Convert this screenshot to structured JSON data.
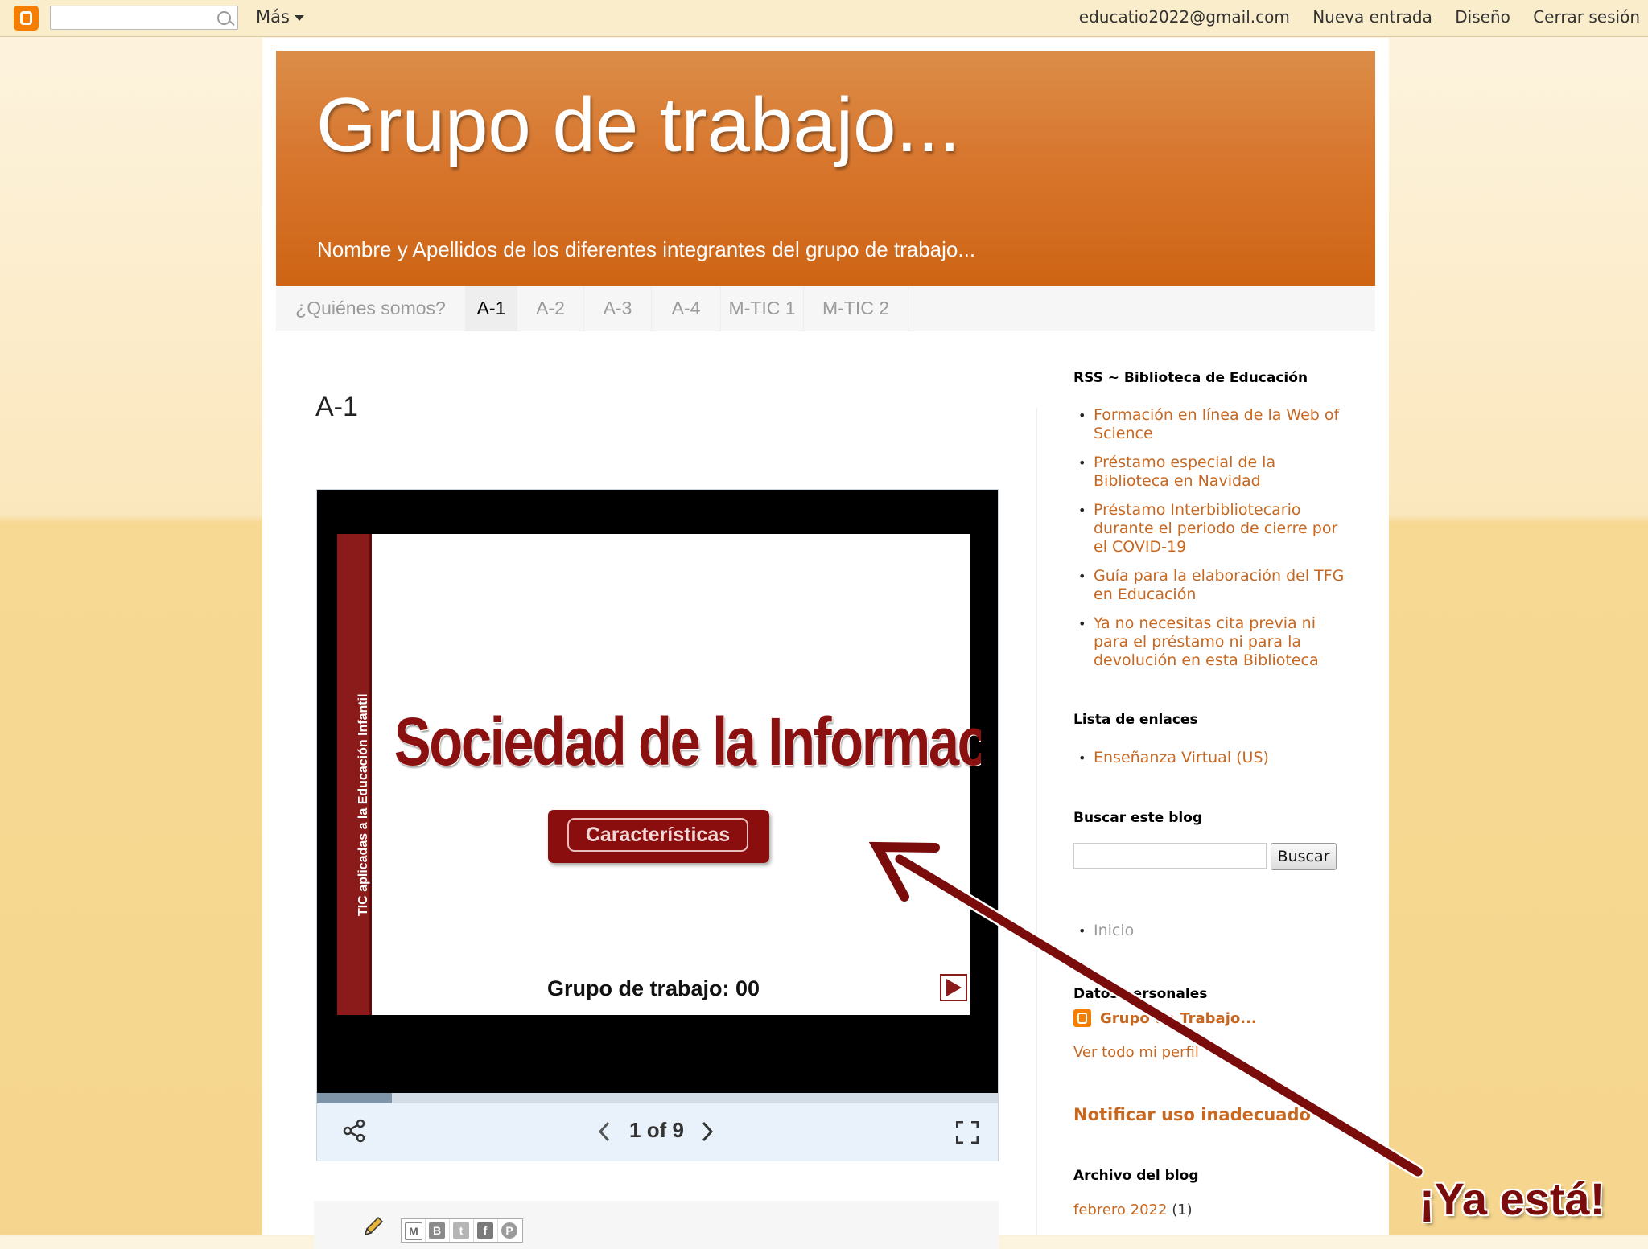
{
  "navbar": {
    "search_placeholder": "",
    "more_label": "Más",
    "email": "educatio2022@gmail.com",
    "new_post": "Nueva entrada",
    "design": "Diseño",
    "sign_out": "Cerrar sesión"
  },
  "header": {
    "title": "Grupo de trabajo...",
    "description": "Nombre y Apellidos de los diferentes integrantes del grupo de trabajo..."
  },
  "tabs": [
    {
      "label": "¿Quiénes somos?",
      "active": false
    },
    {
      "label": "A-1",
      "active": true
    },
    {
      "label": "A-2",
      "active": false
    },
    {
      "label": "A-3",
      "active": false
    },
    {
      "label": "A-4",
      "active": false
    },
    {
      "label": "M-TIC 1",
      "active": false
    },
    {
      "label": "M-TIC 2",
      "active": false
    }
  ],
  "post": {
    "title": "A-1"
  },
  "slideshow": {
    "vertical_text": "TIC aplicadas a la Educación Infantil",
    "slide_title": "Sociedad de la Información",
    "button_label": "Características",
    "footer": "Grupo de trabajo: 00",
    "page_indicator": "1 of 9",
    "progress": 0.11
  },
  "sidebar": {
    "rss_title": "RSS ~ Biblioteca de Educación",
    "rss_items": [
      "Formación en línea de la Web of Science",
      "Préstamo especial de la Biblioteca en Navidad",
      "Préstamo Interbibliotecario durante el periodo de cierre por el COVID-19",
      "Guía para la elaboración del TFG en Educación",
      "Ya no necesitas cita previa ni para el préstamo ni para la devolución en esta Biblioteca"
    ],
    "links_title": "Lista de enlaces",
    "links": [
      "Enseñanza Virtual (US)"
    ],
    "search_title": "Buscar este blog",
    "search_button": "Buscar",
    "pages": [
      "Inicio"
    ],
    "personal_title": "Datos personales",
    "profile_name": "Grupo de Trabajo...",
    "profile_link": "Ver todo mi perfil",
    "report": "Notificar uso inadecuado",
    "archive_title": "Archivo del blog",
    "archive_month": "febrero 2022",
    "archive_count": "(1)"
  },
  "annotation": {
    "callout": "¡Ya está!",
    "color": "#7a0c0c"
  },
  "colors": {
    "header_orange": "#d8772f",
    "link_orange": "#c76720",
    "slide_red": "#8b1a1a"
  }
}
